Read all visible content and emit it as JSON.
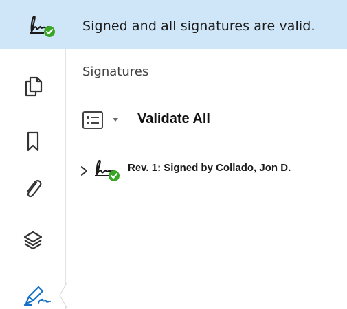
{
  "banner": {
    "icon": "signature-valid-icon",
    "text": "Signed and all signatures are valid."
  },
  "sidebar": {
    "items": [
      {
        "icon": "pages-icon"
      },
      {
        "icon": "bookmark-icon"
      },
      {
        "icon": "attachment-icon"
      },
      {
        "icon": "layers-icon"
      },
      {
        "icon": "signature-pen-icon",
        "active": true
      }
    ]
  },
  "panel": {
    "title": "Signatures",
    "toolbar": {
      "options_icon": "list-options-icon",
      "validate_all_label": "Validate All"
    },
    "signatures": [
      {
        "label": "Rev. 1: Signed by Collado, Jon D.",
        "status_icon": "signature-valid-icon",
        "status_color": "#3aa626"
      }
    ]
  },
  "colors": {
    "banner_bg": "#cfe6f9",
    "valid_green": "#3aa626"
  }
}
